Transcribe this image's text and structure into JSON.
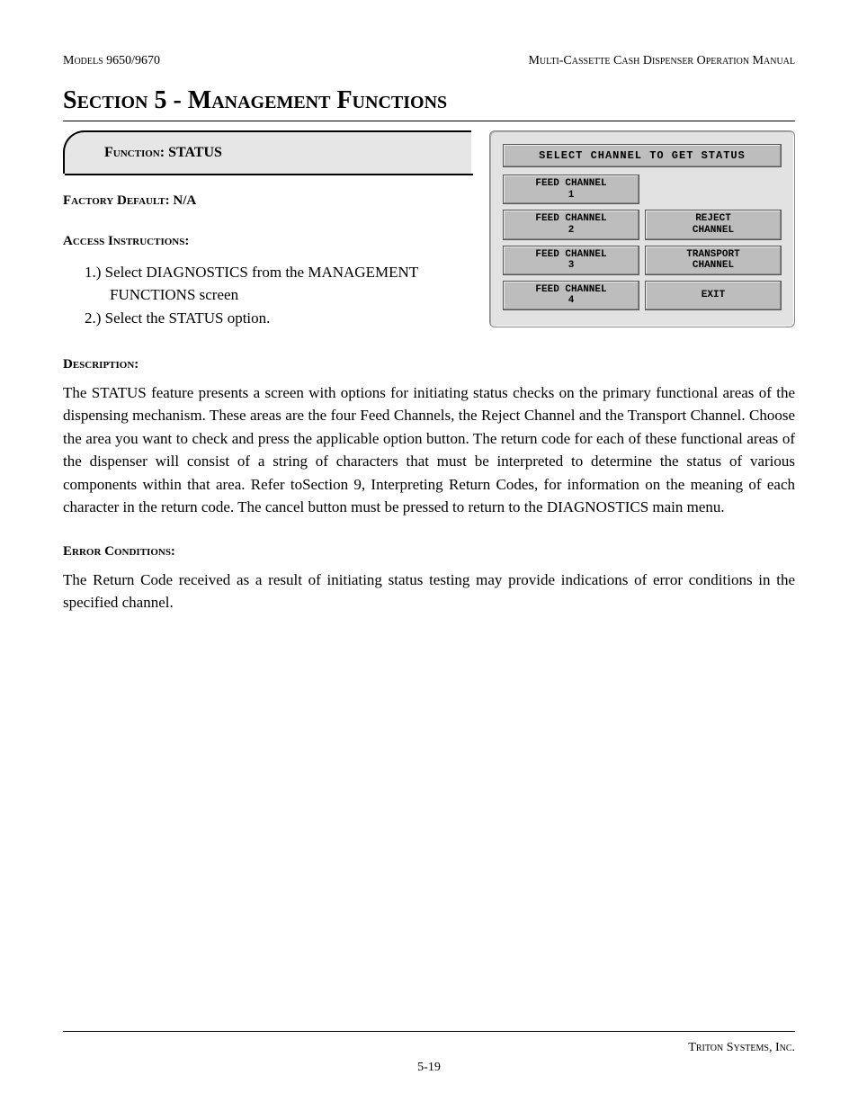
{
  "header": {
    "left": "Models 9650/9670",
    "right": "Multi-Cassette Cash Dispenser Operation Manual"
  },
  "section_title": "Section 5 - Management Functions",
  "function_box": {
    "label_prefix": "Function:",
    "name": "STATUS"
  },
  "factory_default": {
    "label": "Factory Default:",
    "value": "N/A"
  },
  "access": {
    "heading": "Access Instructions:",
    "items": [
      "1.)  Select DIAGNOSTICS from the MANAGEMENT FUNCTIONS screen",
      "2.)  Select the STATUS option."
    ]
  },
  "atm": {
    "title": "SELECT CHANNEL TO GET STATUS",
    "buttons": [
      {
        "label": "FEED CHANNEL\n1",
        "blank": false
      },
      {
        "label": "",
        "blank": true
      },
      {
        "label": "FEED CHANNEL\n2",
        "blank": false
      },
      {
        "label": "REJECT\nCHANNEL",
        "blank": false
      },
      {
        "label": "FEED CHANNEL\n3",
        "blank": false
      },
      {
        "label": "TRANSPORT\nCHANNEL",
        "blank": false
      },
      {
        "label": "FEED CHANNEL\n4",
        "blank": false
      },
      {
        "label": "EXIT",
        "blank": false
      }
    ]
  },
  "description": {
    "heading": "Description:",
    "text": "The STATUS feature presents a screen with options for initiating status checks on the primary functional areas of the dispensing mechanism.  These areas are the four Feed Channels, the Reject Channel and the Transport Channel.  Choose the area you want to check and press the applicable option button. The return code for each of these functional areas of the dispenser will consist of a string of characters that must be interpreted to determine the status of various components within that area. Refer toSection 9, Interpreting Return Codes,  for information on the meaning of each character in the return code. The cancel button must be pressed to return to the DIAGNOSTICS main menu."
  },
  "error": {
    "heading": "Error Conditions:",
    "text": "The Return Code received as a result of initiating status testing may provide indications of error conditions in the specified channel."
  },
  "footer": {
    "company": "Triton Systems, Inc.",
    "page": "5-19"
  }
}
